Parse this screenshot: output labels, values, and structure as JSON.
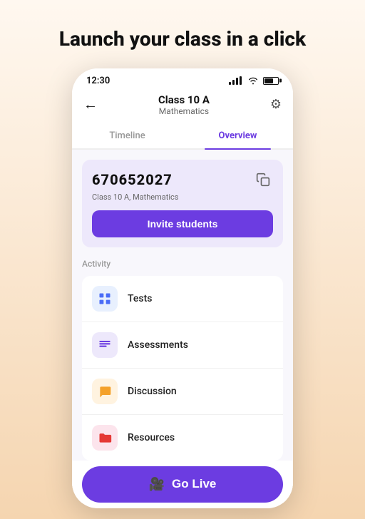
{
  "hero": {
    "title": "Launch your class in a click"
  },
  "status_bar": {
    "time": "12:30"
  },
  "header": {
    "class_name": "Class 10 A",
    "subject": "Mathematics",
    "back_label": "←",
    "gear_label": "⚙"
  },
  "tabs": [
    {
      "label": "Timeline",
      "active": false
    },
    {
      "label": "Overview",
      "active": true
    }
  ],
  "invite_card": {
    "code": "670652027",
    "subtitle": "Class 10 A, Mathematics",
    "button_label": "Invite students"
  },
  "activity": {
    "section_label": "Activity",
    "items": [
      {
        "name": "Tests",
        "icon_color": "#4a6cf7",
        "icon_bg": "#e8f0fe",
        "icon": "▦"
      },
      {
        "name": "Assessments",
        "icon_color": "#6c3ce1",
        "icon_bg": "#ede8fb",
        "icon": "≡"
      },
      {
        "name": "Discussion",
        "icon_color": "#f4a12a",
        "icon_bg": "#fff3e0",
        "icon": "💬"
      },
      {
        "name": "Resources",
        "icon_color": "#e53935",
        "icon_bg": "#fce4ec",
        "icon": "📁"
      }
    ]
  },
  "go_live": {
    "button_label": "Go Live"
  }
}
